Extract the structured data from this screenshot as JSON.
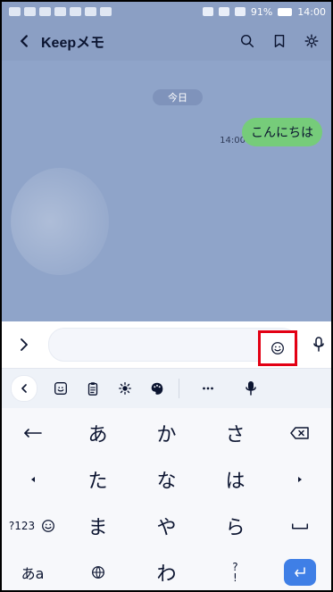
{
  "status_bar": {
    "battery_text": "91%",
    "time": "14:00"
  },
  "header": {
    "title": "Keepメモ"
  },
  "chat": {
    "date_pill": "今日",
    "message": {
      "time": "14:00",
      "text": "こんにちは"
    }
  },
  "keyboard": {
    "row1": [
      "あ",
      "か",
      "さ"
    ],
    "row2": [
      "た",
      "な",
      "は"
    ],
    "row3": [
      "ま",
      "や",
      "ら"
    ],
    "row4": [
      "わ"
    ],
    "mode_label": "?123",
    "kana_label": "あa",
    "punct_top": "?",
    "punct_bottom": "!"
  }
}
